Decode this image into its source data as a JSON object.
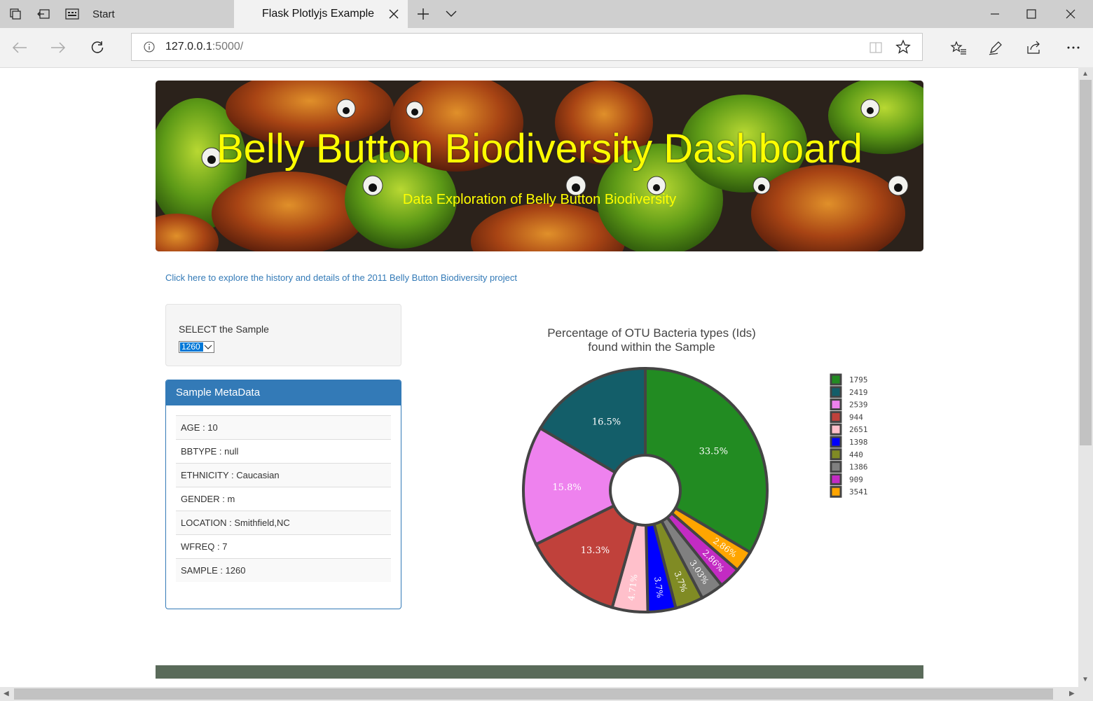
{
  "browser": {
    "tabs": [
      {
        "label": "Start"
      },
      {
        "label": "Flask Plotlyjs Example"
      }
    ],
    "url_host": "127.0.0.1",
    "url_port": ":5000/"
  },
  "banner": {
    "title": "Belly Button Biodiversity Dashboard",
    "subtitle": "Data Exploration of Belly Button Biodiversity"
  },
  "project_link": "Click here to explore the history and details of the 2011 Belly Button Biodiversity project",
  "selector": {
    "label": "SELECT the Sample",
    "value": "1260"
  },
  "metadata": {
    "heading": "Sample MetaData",
    "rows": [
      "AGE : 10",
      "BBTYPE : null",
      "ETHNICITY : Caucasian",
      "GENDER : m",
      "LOCATION : Smithfield,NC",
      "WFREQ : 7",
      "SAMPLE : 1260"
    ]
  },
  "chart_data": {
    "type": "pie",
    "title": "Percentage of OTU Bacteria types (Ids) found within the Sample",
    "title_lines": [
      "Percentage of OTU Bacteria types (Ids)",
      "found within the Sample"
    ],
    "hole": true,
    "legend_position": "right",
    "labels": [
      "1795",
      "2419",
      "2539",
      "944",
      "2651",
      "1398",
      "440",
      "1386",
      "909",
      "3541"
    ],
    "values": [
      33.5,
      16.5,
      15.8,
      13.3,
      4.71,
      3.7,
      3.7,
      3.03,
      2.86,
      2.86
    ],
    "text_labels": [
      "33.5%",
      "16.5%",
      "15.8%",
      "13.3%",
      "4.71%",
      "3.7%",
      "3.7%",
      "3.03%",
      "2.86%",
      "2.86%"
    ],
    "colors": [
      "#228b22",
      "#135e69",
      "#ee82ee",
      "#c0413b",
      "#ffc0cb",
      "#0000ff",
      "#808b24",
      "#808080",
      "#c32bc3",
      "#ffa500"
    ],
    "slice_order": [
      0,
      9,
      8,
      7,
      6,
      5,
      4,
      3,
      2,
      1
    ]
  }
}
